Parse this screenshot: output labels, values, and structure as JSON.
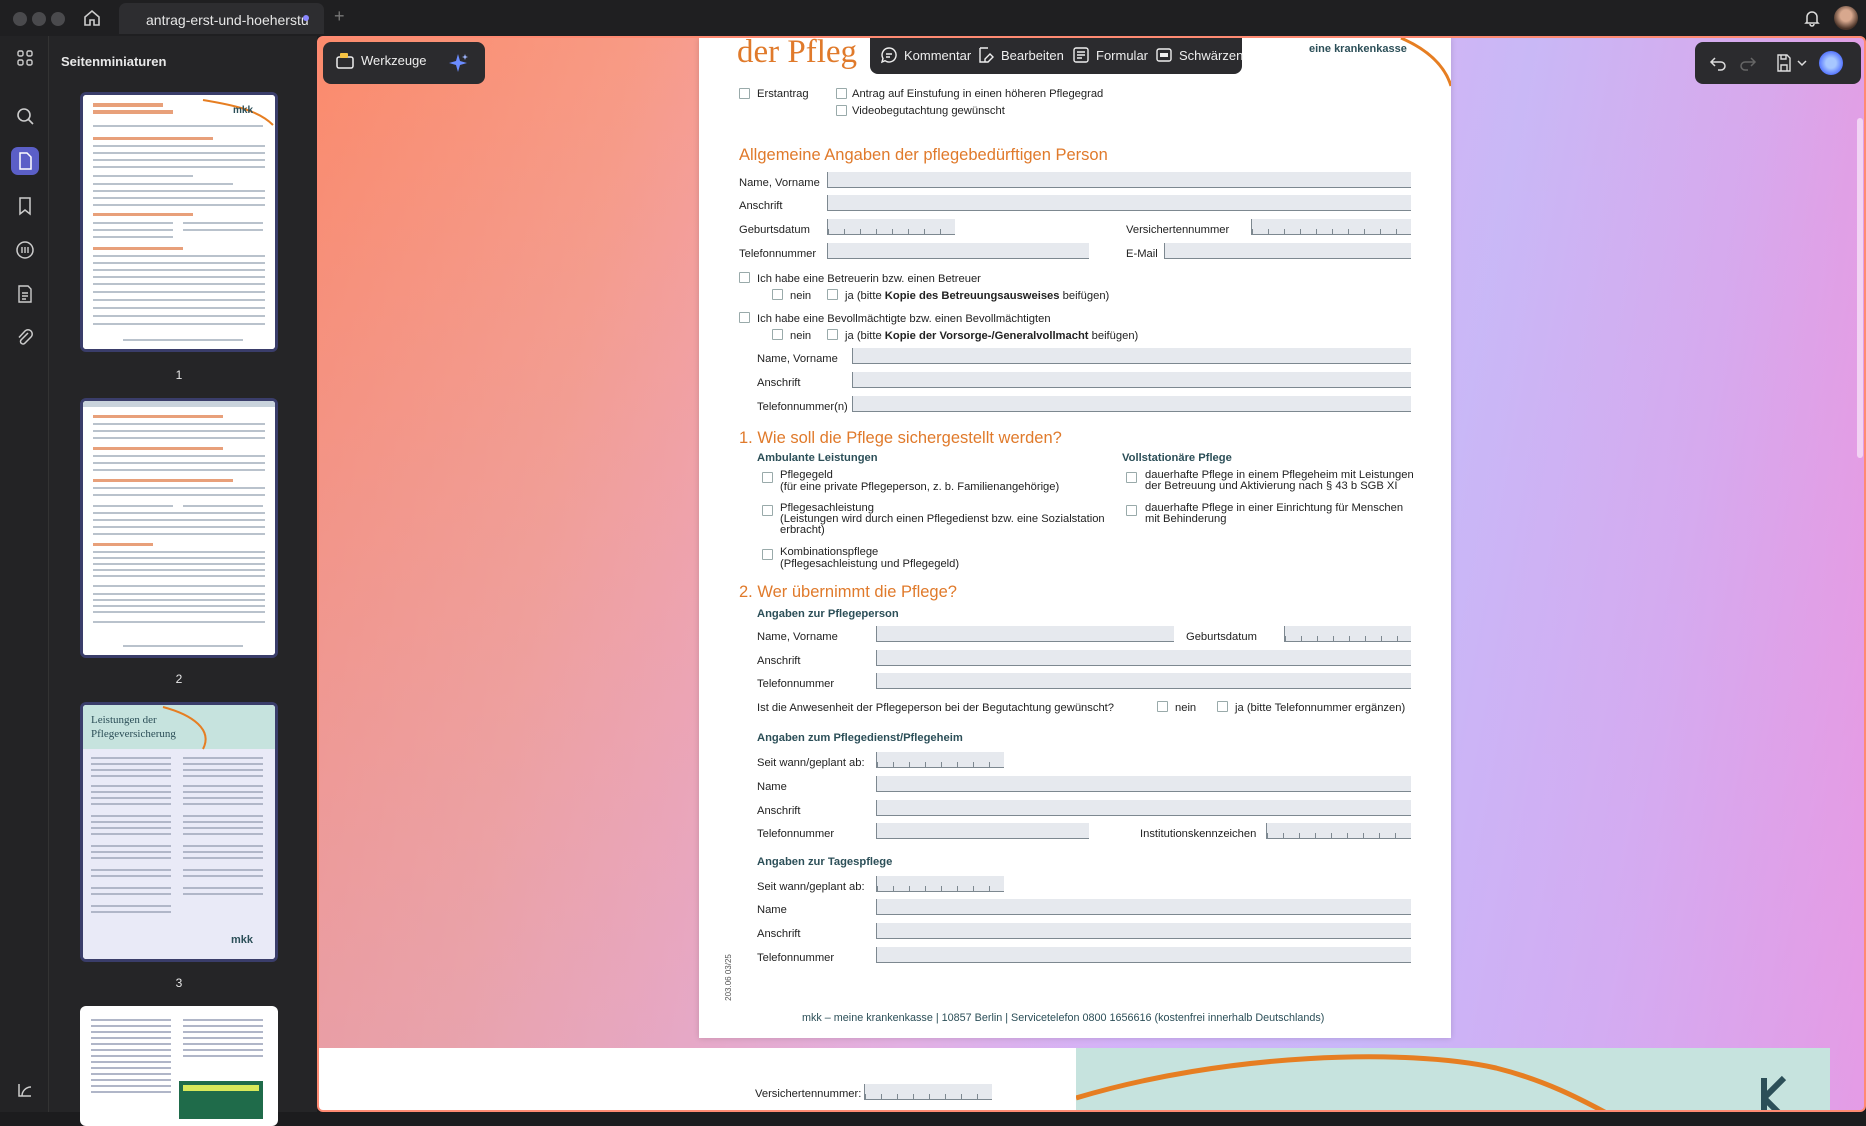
{
  "window": {
    "tab_title": "antrag-erst-und-hoeherstu"
  },
  "sidebar": {
    "title": "Seitenminiaturen",
    "pages": [
      "1",
      "2",
      "3"
    ]
  },
  "tools_bar": {
    "tools_label": "Werkzeuge"
  },
  "edit_bar": {
    "comment": "Kommentar",
    "edit": "Bearbeiten",
    "form": "Formular",
    "redact": "Schwärzen"
  },
  "doc": {
    "title_fragment": "der Pfleg",
    "brand_fragment": "eine krankenkasse",
    "erstantrag": "Erstantrag",
    "hoeher": "Antrag auf Einstufung in einen höheren Pflegegrad",
    "video": "Videobegutachtung gewünscht",
    "section_general": "Allgemeine Angaben der pflegebedürftigen Person",
    "name": "Name, Vorname",
    "anschrift": "Anschrift",
    "geburtsdatum": "Geburtsdatum",
    "versichertennummer": "Versichertennummer",
    "telefonnummer": "Telefonnummer",
    "email": "E-Mail",
    "betreuer": "Ich habe eine Betreuerin bzw. einen Betreuer",
    "nein": "nein",
    "ja_betreuer_a": "ja (bitte ",
    "ja_betreuer_b": "Kopie des Betreuungsausweises",
    "ja_betreuer_c": " beifügen)",
    "bevollmaechtigt": "Ich habe eine Bevollmächtigte bzw. einen Bevollmächtigten",
    "ja_voll_a": "ja  (bitte ",
    "ja_voll_b": "Kopie der Vorsorge-/Generalvollmacht",
    "ja_voll_c": " beifügen)",
    "telefonnummer_n": "Telefonnummer(n)",
    "section1": "1. Wie soll die Pflege sichergestellt werden?",
    "ambulant": "Ambulante Leistungen",
    "vollstationaer": "Vollstationäre Pflege",
    "pflegegeld": "Pflegegeld",
    "pflegegeld_sub": "(für eine private Pflegeperson, z. b. Familienangehörige)",
    "sach": "Pflegesachleistung",
    "sach_sub1": "(Leistungen wird durch einen Pflegedienst bzw. eine Sozialstation",
    "sach_sub2": "erbracht)",
    "kombi": "Kombinationspflege",
    "kombi_sub": "(Pflegesachleistung und Pflegegeld)",
    "heim1a": "dauerhafte Pflege in einem Pflegeheim mit Leistungen",
    "heim1b": "der Betreuung und Aktivierung nach § 43 b SGB XI",
    "heim2a": "dauerhafte Pflege in einer Einrichtung für Menschen",
    "heim2b": "mit Behinderung",
    "section2": "2. Wer übernimmt die Pflege?",
    "pflegeperson": "Angaben zur Pflegeperson",
    "anwesenheit": "Ist die Anwesenheit der Pflegeperson bei der Begutachtung gewünscht?",
    "ja_tel": "ja (bitte Telefonnummer ergänzen)",
    "pflegedienst": "Angaben zum Pflegedienst/Pflegeheim",
    "seit": "Seit wann/geplant ab:",
    "name_only": "Name",
    "institution": "Institutionskennzeichen",
    "tagespflege": "Angaben zur Tagespflege",
    "side_code": "203.06 03/25",
    "footer": "mkk – meine krankenkasse  |  10857 Berlin  |  Servicetelefon 0800 1656616 (kostenfrei innerhalb Deutschlands)",
    "next_page_label": "Versichertennummer:"
  },
  "thumbs": {
    "logo": "mkk",
    "t3_title1": "Leistungen der",
    "t3_title2": "Pflegeversicherung"
  },
  "colors": {
    "accent": "#e07a2b",
    "teal": "#2c4f58",
    "selection": "#5b5fc7"
  }
}
